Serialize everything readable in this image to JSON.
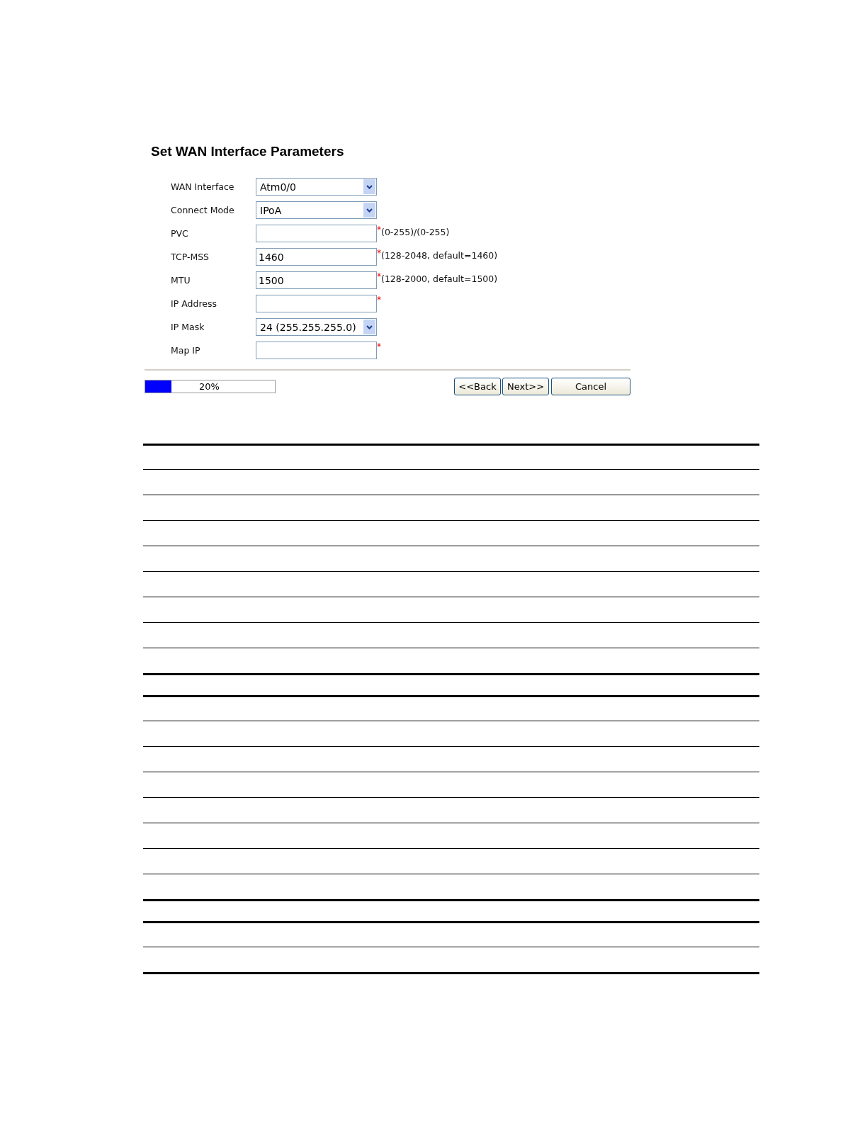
{
  "title": "Set WAN Interface Parameters",
  "fields": [
    {
      "label": "WAN Interface",
      "kind": "select",
      "value": "Atm0/0"
    },
    {
      "label": "Connect Mode",
      "kind": "select",
      "value": "IPoA"
    },
    {
      "label": "PVC",
      "kind": "text",
      "mark": "*",
      "hint": "(0-255)/(0-255)"
    },
    {
      "label": "TCP-MSS",
      "kind": "text",
      "value": "1460",
      "mark": "*",
      "hint": "(128-2048, default=1460)"
    },
    {
      "label": "MTU",
      "kind": "text",
      "value": "1500",
      "mark": "*",
      "hint": "(128-2000, default=1500)"
    },
    {
      "label": "IP Address",
      "kind": "text",
      "mark": "*"
    },
    {
      "label": "IP Mask",
      "kind": "select",
      "value": "24 (255.255.255.0)"
    },
    {
      "label": "Map IP",
      "kind": "text",
      "mark": "*"
    }
  ],
  "progress": {
    "level": 0.2,
    "reading": "20%"
  },
  "buttons": [
    "<<Back",
    "Next>>",
    "Cancel"
  ]
}
